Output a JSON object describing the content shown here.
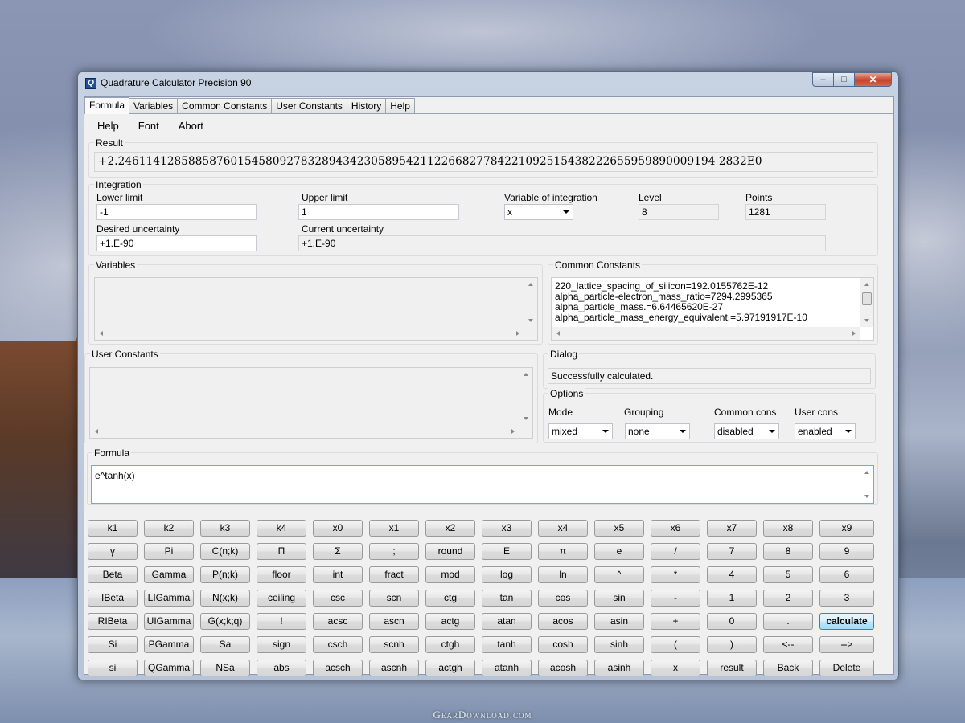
{
  "window": {
    "title": "Quadrature Calculator Precision 90",
    "icon_letter": "Q"
  },
  "tabs": [
    {
      "label": "Formula"
    },
    {
      "label": "Variables"
    },
    {
      "label": "Common Constants"
    },
    {
      "label": "User Constants"
    },
    {
      "label": "History"
    },
    {
      "label": "Help"
    }
  ],
  "menu": [
    {
      "label": "Help"
    },
    {
      "label": "Font"
    },
    {
      "label": "Abort"
    }
  ],
  "result": {
    "label": "Result",
    "value": "+2.2461141285885876015458092783289434230589542112266827784221092515438222655959890009194 2832E0"
  },
  "integration": {
    "label": "Integration",
    "lower_limit": {
      "label": "Lower limit",
      "value": "-1"
    },
    "upper_limit": {
      "label": "Upper limit",
      "value": "1"
    },
    "variable": {
      "label": "Variable of integration",
      "value": "x"
    },
    "level": {
      "label": "Level",
      "value": "8"
    },
    "points": {
      "label": "Points",
      "value": "1281"
    },
    "desired_uncertainty": {
      "label": "Desired uncertainty",
      "value": "+1.E-90"
    },
    "current_uncertainty": {
      "label": "Current uncertainty",
      "value": "+1.E-90"
    }
  },
  "variables": {
    "label": "Variables"
  },
  "common_constants": {
    "label": "Common Constants",
    "items": [
      "220_lattice_spacing_of_silicon=192.0155762E-12",
      "alpha_particle-electron_mass_ratio=7294.2995365",
      "alpha_particle_mass.=6.64465620E-27",
      "alpha_particle_mass_energy_equivalent.=5.97191917E-10"
    ]
  },
  "user_constants": {
    "label": "User Constants"
  },
  "dialog": {
    "label": "Dialog",
    "message": "Successfully calculated."
  },
  "options": {
    "label": "Options",
    "mode": {
      "label": "Mode",
      "value": "mixed"
    },
    "grouping": {
      "label": "Grouping",
      "value": "none"
    },
    "common_cons": {
      "label": "Common cons",
      "value": "disabled"
    },
    "user_cons": {
      "label": "User cons",
      "value": "enabled"
    }
  },
  "formula": {
    "label": "Formula",
    "value": "e^tanh(x)"
  },
  "keypad": [
    [
      "k1",
      "k2",
      "k3",
      "k4",
      "x0",
      "x1",
      "x2",
      "x3",
      "x4",
      "x5",
      "x6",
      "x7",
      "x8",
      "x9"
    ],
    [
      "γ",
      "Pi",
      "C(n;k)",
      "Π",
      "Σ",
      ";",
      "round",
      "E",
      "π",
      "e",
      "/",
      "7",
      "8",
      "9"
    ],
    [
      "Beta",
      "Gamma",
      "P(n;k)",
      "floor",
      "int",
      "fract",
      "mod",
      "log",
      "ln",
      "^",
      "*",
      "4",
      "5",
      "6"
    ],
    [
      "IBeta",
      "LIGamma",
      "N(x;k)",
      "ceiling",
      "csc",
      "scn",
      "ctg",
      "tan",
      "cos",
      "sin",
      "-",
      "1",
      "2",
      "3"
    ],
    [
      "RIBeta",
      "UIGamma",
      "G(x;k;q)",
      "!",
      "acsc",
      "ascn",
      "actg",
      "atan",
      "acos",
      "asin",
      "+",
      "0",
      ".",
      "calculate"
    ],
    [
      "Si",
      "PGamma",
      "Sa",
      "sign",
      "csch",
      "scnh",
      "ctgh",
      "tanh",
      "cosh",
      "sinh",
      "(",
      ")",
      "<--",
      "-->"
    ],
    [
      "si",
      "QGamma",
      "NSa",
      "abs",
      "acsch",
      "ascnh",
      "actgh",
      "atanh",
      "acosh",
      "asinh",
      "x",
      "result",
      "Back",
      "Delete"
    ]
  ],
  "watermark": "GearDownload.com"
}
